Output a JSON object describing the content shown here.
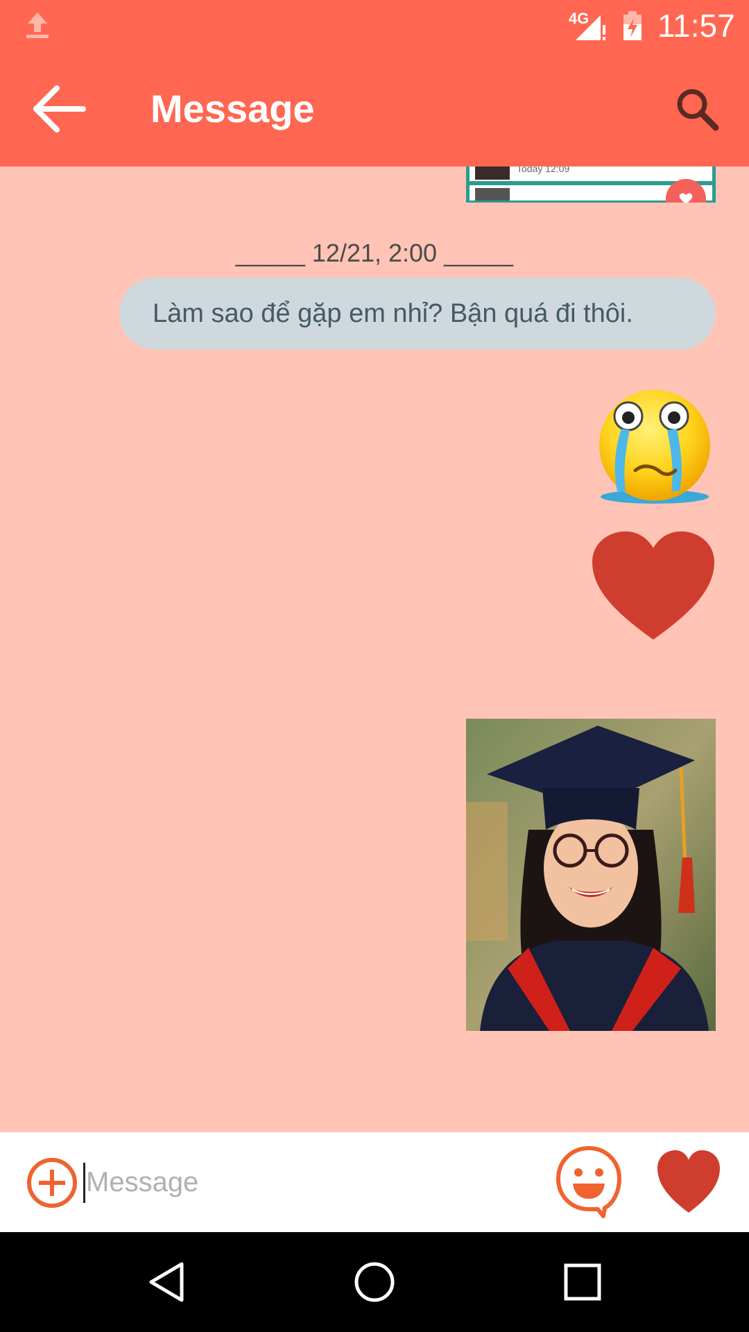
{
  "status_bar": {
    "network": "4G",
    "time": "11:57",
    "icons": [
      "upload-icon",
      "signal-icon",
      "battery-charging-icon"
    ]
  },
  "app_bar": {
    "title": "Message",
    "back_icon": "arrow-back-icon",
    "search_icon": "search-icon"
  },
  "chat": {
    "previous_card": {
      "time": "Today 12:09"
    },
    "date_separator": "_____ 12/21, 2:00 _____",
    "messages": [
      {
        "type": "text",
        "text": "Làm sao để gặp em nhỉ? Bận quá đi thôi."
      },
      {
        "type": "sticker",
        "icon": "crying-face-sticker"
      },
      {
        "type": "sticker",
        "icon": "heart-sticker"
      },
      {
        "type": "image",
        "icon": "graduation-photo"
      }
    ]
  },
  "composer": {
    "placeholder": "Message",
    "value": "",
    "add_icon": "add-circle-icon",
    "emoji_icon": "emoji-icon",
    "like_icon": "heart-icon"
  },
  "colors": {
    "primary": "#ff6752",
    "chat_background": "#ffc4b5",
    "bubble": "#cfd8dc",
    "accent": "#f0632f",
    "heart": "#cf3d2e"
  },
  "nav_bar": {
    "icons": [
      "nav-back-icon",
      "nav-home-icon",
      "nav-recent-icon"
    ]
  }
}
